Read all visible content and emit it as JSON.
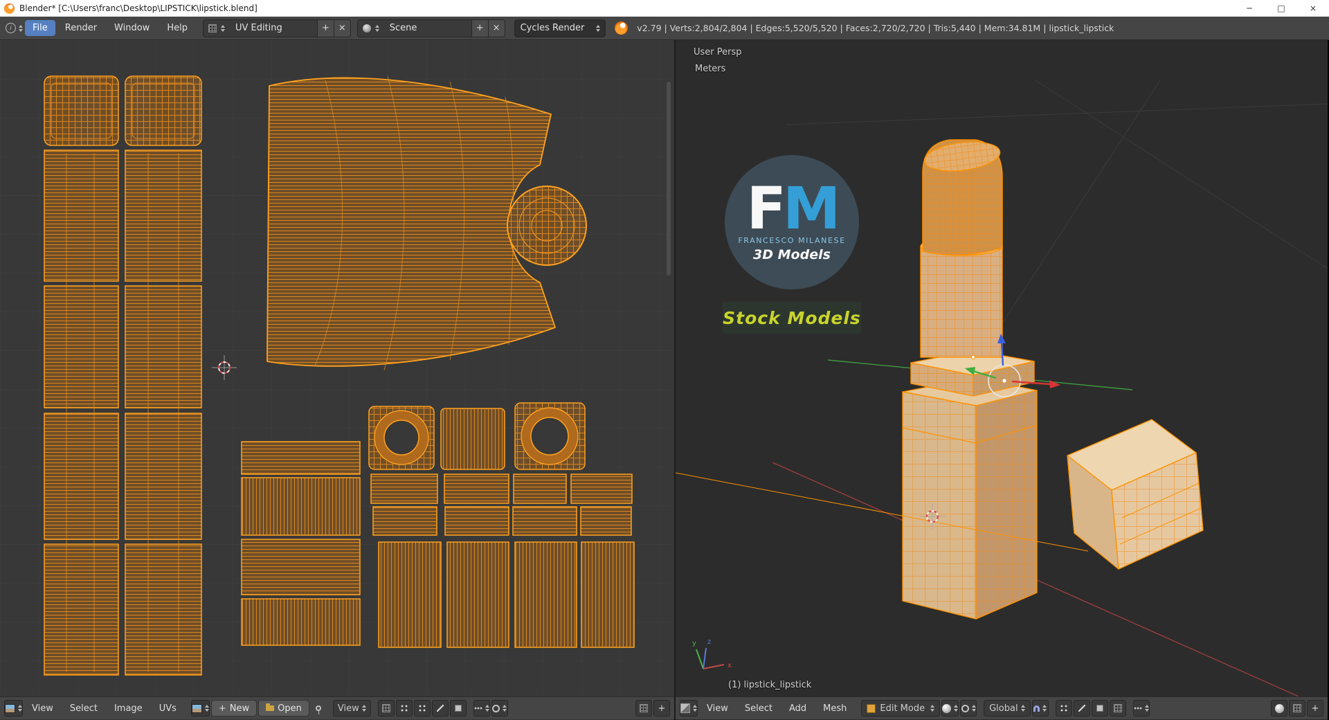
{
  "icons": {
    "minimize": "─",
    "maximize": "□",
    "close": "×",
    "plus": "+",
    "x": "×"
  },
  "window": {
    "title": "Blender* [C:\\Users\\franc\\Desktop\\LIPSTICK\\lipstick.blend]"
  },
  "top_header": {
    "menus": [
      "File",
      "Render",
      "Window",
      "Help"
    ],
    "layout_name": "UV Editing",
    "scene_name": "Scene",
    "engine_name": "Cycles Render",
    "stats": "v2.79 | Verts:2,804/2,804 | Edges:5,520/5,520 | Faces:2,720/2,720 | Tris:5,440 | Mem:34.81M | lipstick_lipstick"
  },
  "uv_editor": {
    "header": {
      "menus": [
        "View",
        "Select",
        "Image",
        "UVs"
      ],
      "new_label": "New",
      "open_label": "Open",
      "mode_label": "View"
    }
  },
  "viewport_3d": {
    "overlay": {
      "view_name": "User Persp",
      "unit": "Meters",
      "object_info": "(1) lipstick_lipstick"
    },
    "watermark": {
      "initial_f": "F",
      "initial_m": "M",
      "name": "FRANCESCO MILANESE",
      "subtitle": "3D Models",
      "stock": "Stock Models"
    },
    "header": {
      "menus": [
        "View",
        "Select",
        "Add",
        "Mesh"
      ],
      "mode_label": "Edit Mode",
      "orientation_label": "Global"
    }
  }
}
